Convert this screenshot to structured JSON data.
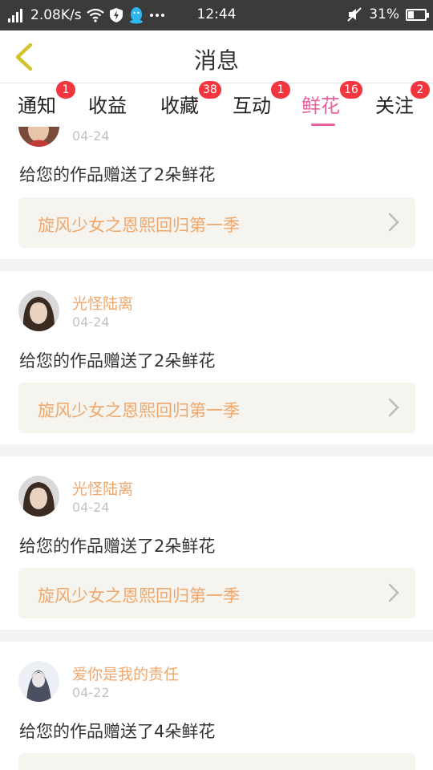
{
  "status_bar": {
    "speed": "2.08K/s",
    "time": "12:44",
    "battery": "31%"
  },
  "header": {
    "title": "消息",
    "back_icon": "chevron-left-icon"
  },
  "tabs": [
    {
      "label": "通知",
      "badge": "1"
    },
    {
      "label": "收益",
      "badge": ""
    },
    {
      "label": "收藏",
      "badge": "38"
    },
    {
      "label": "互动",
      "badge": "1"
    },
    {
      "label": "鲜花",
      "badge": "16",
      "active": true
    },
    {
      "label": "关注",
      "badge": "2"
    }
  ],
  "notifications": [
    {
      "user": "",
      "date": "04-24",
      "message": "给您的作品赠送了2朵鲜花",
      "work_title": "旋风少女之恩熙回归第一季"
    },
    {
      "user": "光怪陆离",
      "date": "04-24",
      "message": "给您的作品赠送了2朵鲜花",
      "work_title": "旋风少女之恩熙回归第一季"
    },
    {
      "user": "光怪陆离",
      "date": "04-24",
      "message": "给您的作品赠送了2朵鲜花",
      "work_title": "旋风少女之恩熙回归第一季"
    },
    {
      "user": "爱你是我的责任",
      "date": "04-22",
      "message": "给您的作品赠送了4朵鲜花",
      "work_title": ""
    }
  ],
  "colors": {
    "accent": "#e8629c",
    "work_text": "#f0a76b",
    "badge": "#f2353f"
  }
}
